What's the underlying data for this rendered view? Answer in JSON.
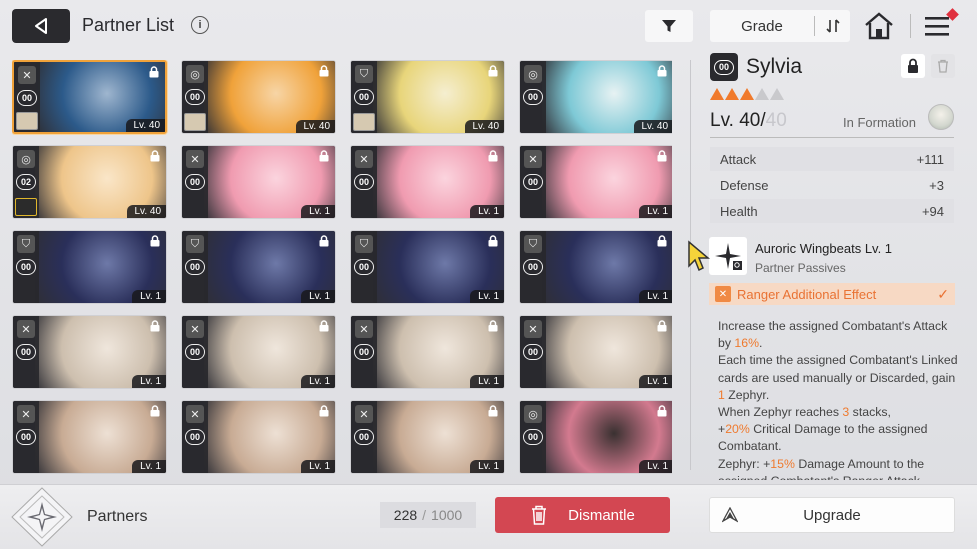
{
  "header": {
    "title": "Partner List",
    "info_icon": "info-icon",
    "filter_icon": "filter-icon",
    "sort_label": "Grade",
    "sort_icon": "sort-order-icon",
    "home_icon": "home-icon",
    "menu_icon": "menu-icon"
  },
  "grid": {
    "cards": [
      {
        "num": "00",
        "level": "Lv. 40",
        "class": "sword",
        "selected": true,
        "mini": true,
        "art": [
          "#2c5a8a",
          "#9fb6cf"
        ]
      },
      {
        "num": "00",
        "level": "Lv. 40",
        "class": "target",
        "selected": false,
        "mini": true,
        "art": [
          "#f0a23a",
          "#f7d5a6"
        ]
      },
      {
        "num": "00",
        "level": "Lv. 40",
        "class": "shield",
        "selected": false,
        "mini": true,
        "art": [
          "#e8d57a",
          "#f5eed0"
        ]
      },
      {
        "num": "00",
        "level": "Lv. 40",
        "class": "target",
        "selected": false,
        "mini": false,
        "art": [
          "#7ec9d6",
          "#e7f2f3"
        ]
      },
      {
        "num": "02",
        "level": "Lv. 40",
        "class": "target",
        "selected": false,
        "mini": true,
        "gold": true,
        "art": [
          "#eec58a",
          "#fae6c8"
        ]
      },
      {
        "num": "00",
        "level": "Lv. 1",
        "class": "sword",
        "selected": false,
        "mini": false,
        "art": [
          "#f09bb0",
          "#fbd4de"
        ]
      },
      {
        "num": "00",
        "level": "Lv. 1",
        "class": "sword",
        "selected": false,
        "mini": false,
        "art": [
          "#f09bb0",
          "#fbd4de"
        ]
      },
      {
        "num": "00",
        "level": "Lv. 1",
        "class": "sword",
        "selected": false,
        "mini": false,
        "art": [
          "#f09bb0",
          "#fbd4de"
        ]
      },
      {
        "num": "00",
        "level": "Lv. 1",
        "class": "shield",
        "selected": false,
        "mini": false,
        "art": [
          "#2a2f5a",
          "#6e79a8"
        ]
      },
      {
        "num": "00",
        "level": "Lv. 1",
        "class": "shield",
        "selected": false,
        "mini": false,
        "art": [
          "#2a2f5a",
          "#6e79a8"
        ]
      },
      {
        "num": "00",
        "level": "Lv. 1",
        "class": "shield",
        "selected": false,
        "mini": false,
        "art": [
          "#2a2f5a",
          "#6e79a8"
        ]
      },
      {
        "num": "00",
        "level": "Lv. 1",
        "class": "shield",
        "selected": false,
        "mini": false,
        "art": [
          "#2a2f5a",
          "#6e79a8"
        ]
      },
      {
        "num": "00",
        "level": "Lv. 1",
        "class": "sword",
        "selected": false,
        "mini": false,
        "art": [
          "#cdbfae",
          "#efe6dc"
        ]
      },
      {
        "num": "00",
        "level": "Lv. 1",
        "class": "sword",
        "selected": false,
        "mini": false,
        "art": [
          "#cdbfae",
          "#efe6dc"
        ]
      },
      {
        "num": "00",
        "level": "Lv. 1",
        "class": "sword",
        "selected": false,
        "mini": false,
        "art": [
          "#cdbfae",
          "#efe6dc"
        ]
      },
      {
        "num": "00",
        "level": "Lv. 1",
        "class": "sword",
        "selected": false,
        "mini": false,
        "art": [
          "#cdbfae",
          "#efe6dc"
        ]
      },
      {
        "num": "00",
        "level": "Lv. 1",
        "class": "sword",
        "selected": false,
        "mini": false,
        "art": [
          "#c8ab94",
          "#ede0d4"
        ]
      },
      {
        "num": "00",
        "level": "Lv. 1",
        "class": "sword",
        "selected": false,
        "mini": false,
        "art": [
          "#c8ab94",
          "#ede0d4"
        ]
      },
      {
        "num": "00",
        "level": "Lv. 1",
        "class": "sword",
        "selected": false,
        "mini": false,
        "art": [
          "#c8ab94",
          "#ede0d4"
        ]
      },
      {
        "num": "00",
        "level": "Lv. 1",
        "class": "target",
        "selected": false,
        "mini": false,
        "art": [
          "#d37a8f",
          "#3a3131"
        ]
      }
    ]
  },
  "detail": {
    "rarity_num": "00",
    "name": "Sylvia",
    "stars_filled": 3,
    "stars_total": 5,
    "level_current": "Lv. 40/",
    "level_max": "40",
    "in_formation": "In Formation",
    "stats": [
      {
        "label": "Attack",
        "value": "+111"
      },
      {
        "label": "Defense",
        "value": "+3"
      },
      {
        "label": "Health",
        "value": "+94"
      }
    ],
    "skill_name": "Auroric Wingbeats Lv. 1",
    "skill_sub": "Partner Passives",
    "effect_label": "Ranger Additional Effect",
    "desc": {
      "l1a": "Increase the assigned Combatant's Attack by ",
      "l1b": "16%",
      "l1c": ".",
      "l2a": "Each time the assigned Combatant's Linked cards are used manually or Discarded, gain ",
      "l2b": "1",
      "l2c": " Zephyr.",
      "l3a": "When Zephyr reaches ",
      "l3b": "3",
      "l3c": " stacks,",
      "l4a": "+",
      "l4b": "20%",
      "l4c": " Critical Damage to the assigned Combatant.",
      "l5a": "Zephyr: +",
      "l5b": "15%",
      "l5c": " Damage Amount to the assigned Combatant's Ranger Attack"
    }
  },
  "footer": {
    "partners_label": "Partners",
    "count_current": "228",
    "count_sep": "/",
    "count_total": "1000",
    "dismantle_label": "Dismantle",
    "upgrade_label": "Upgrade"
  },
  "colors": {
    "accent_orange": "#ef7a2e",
    "dismantle_red": "#d34752",
    "selected_border": "#f0a23a"
  }
}
